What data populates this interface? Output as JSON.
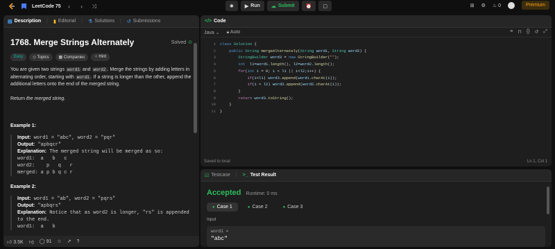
{
  "topbar": {
    "breadcrumb": "LeetCode 75",
    "run_label": "Run",
    "submit_label": "Submit",
    "streak_count": "0",
    "premium_label": "Premium"
  },
  "left_tabs": [
    "Description",
    "Editorial",
    "Solutions",
    "Submissions"
  ],
  "problem": {
    "title": "1768. Merge Strings Alternately",
    "status": "Solved",
    "pills": [
      "Easy",
      "Topics",
      "Companies",
      "Hint"
    ],
    "para1_a": "You are given two strings ",
    "code_w1": "word1",
    "para1_b": " and ",
    "code_w2": "word2",
    "para1_c": ". Merge the strings by adding letters in alternating order, starting with ",
    "para1_d": ". If a string is longer than the other, append the additional letters onto the end of the merged string.",
    "return_a": "Return ",
    "return_b": "the merged string",
    "return_c": ".",
    "example1_title": "Example 1:",
    "example1": {
      "input_label": "Input:",
      "input": " word1 = \"abc\", word2 = \"pqr\"",
      "output_label": "Output:",
      "output": " \"apbqcr\"",
      "expl_label": "Explanation:",
      "expl": " The merged string will be merged as so:",
      "l1": "word1:  a   b   c",
      "l2": "word2:    p   q   r",
      "l3": "merged: a p b q c r"
    },
    "example2_title": "Example 2:",
    "example2": {
      "input_label": "Input:",
      "input": " word1 = \"ab\", word2 = \"pqrs\"",
      "output_label": "Output:",
      "output": " \"apbqrs\"",
      "expl_label": "Explanation:",
      "expl": " Notice that as word2 is longer, \"rs\" is appended to the end.",
      "l1": "word1:  a   b"
    }
  },
  "bottombar": {
    "likes": "3.5K",
    "comments": "91"
  },
  "code_panel": {
    "tab": "Code",
    "language": "Java",
    "mode": "Auto",
    "status_left": "Saved to local",
    "status_right": "Ln 1, Col 1"
  },
  "test_panel": {
    "tab_testcase": "Testcase",
    "tab_result": "Test Result",
    "result": "Accepted",
    "runtime": "Runtime: 0 ms",
    "cases": [
      "Case 1",
      "Case 2",
      "Case 3"
    ],
    "input_label": "Input",
    "var_label": "word1 =",
    "var_value": "\"abc\""
  }
}
